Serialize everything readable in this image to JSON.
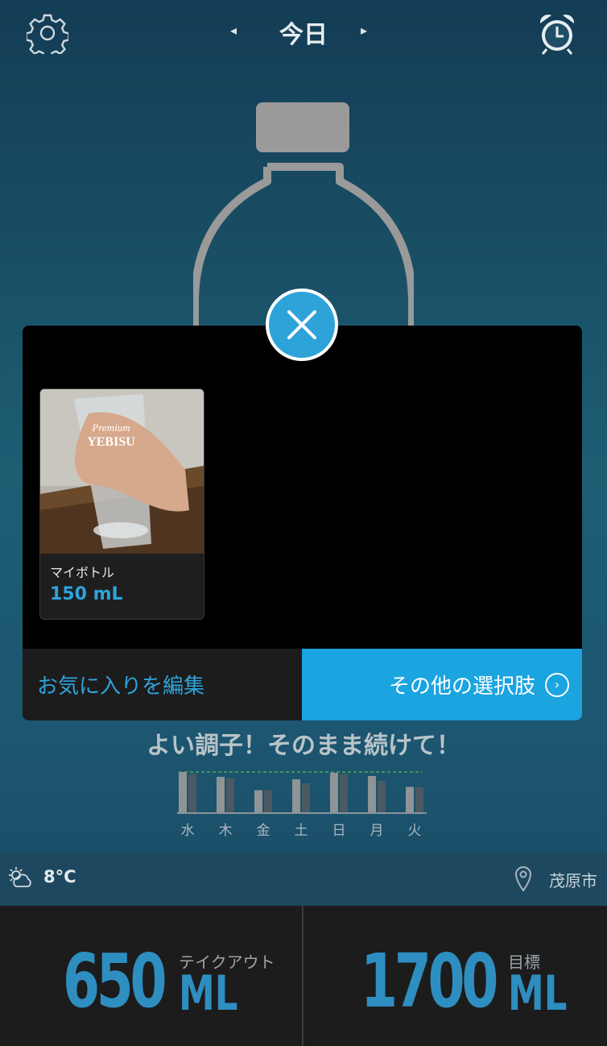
{
  "header": {
    "title": "今日",
    "prev_arrow": "◂",
    "next_arrow": "▸",
    "left_icon": "gear-icon",
    "right_icon": "alarm-clock-icon"
  },
  "modal": {
    "favorite_item": {
      "name": "マイボトル",
      "amount": "150 mL",
      "photo_brand": "YEBISU",
      "photo_script": "Premium"
    },
    "edit_favorites_label": "お気に入りを編集",
    "more_options_label": "その他の選択肢"
  },
  "motivation": "よい調子！そのまま続けて！",
  "week_chart": {
    "days": [
      "水",
      "木",
      "金",
      "土",
      "日",
      "月",
      "火"
    ],
    "intake_fraction": [
      1.0,
      0.88,
      0.55,
      0.82,
      0.98,
      0.9,
      0.63
    ],
    "target_fraction": [
      0.95,
      0.85,
      0.55,
      0.72,
      0.95,
      0.78,
      0.62
    ]
  },
  "weather": {
    "temperature": "8°C",
    "city": "茂原市",
    "weather_icon": "partly-cloudy-icon",
    "location_icon": "location-pin-icon"
  },
  "stats": {
    "takeout_value": "650",
    "takeout_unit": "ML",
    "takeout_label": "テイクアウト",
    "goal_value": "1700",
    "goal_unit": "ML",
    "goal_label": "目標"
  },
  "colors": {
    "accent": "#2ea3da",
    "stat_blue": "#2e8ec0"
  }
}
